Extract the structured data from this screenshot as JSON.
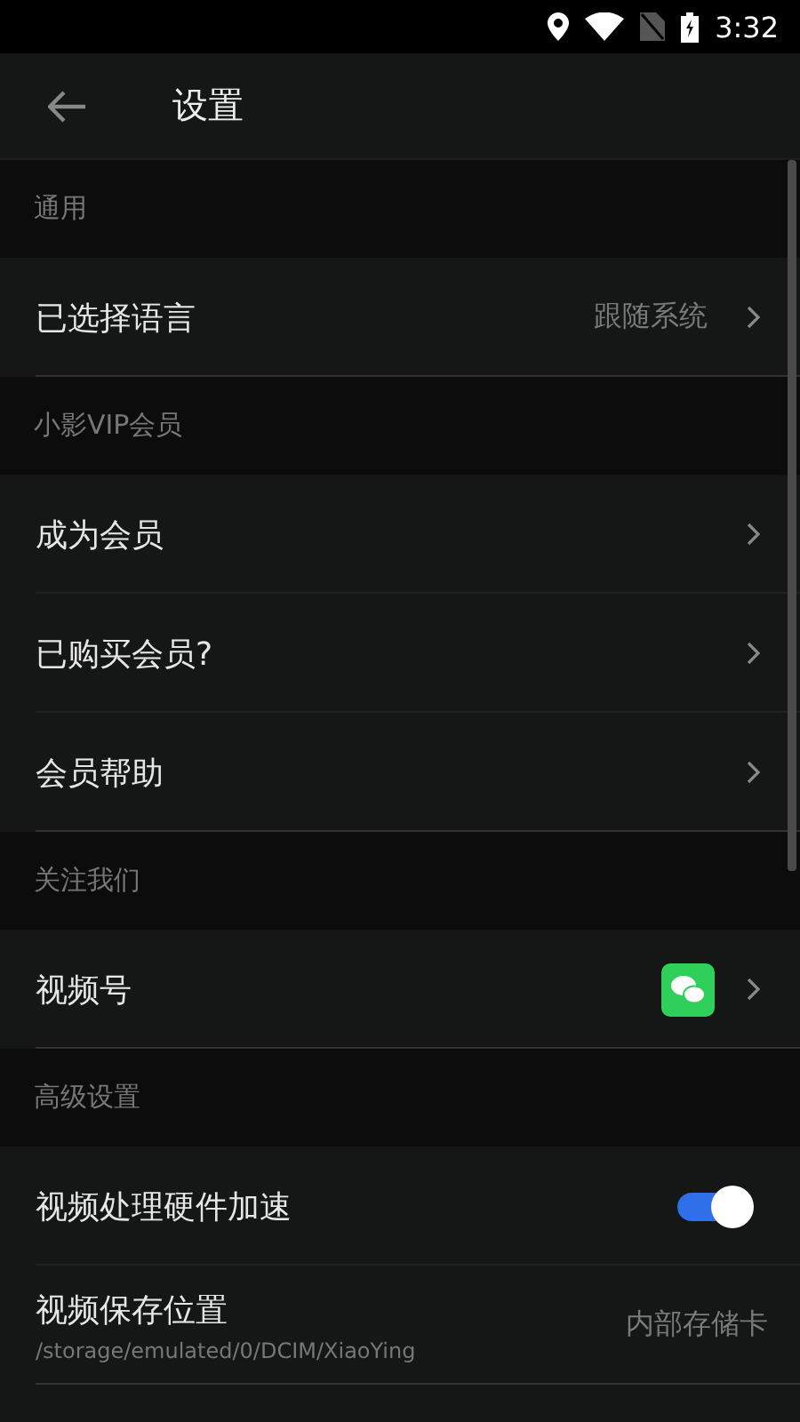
{
  "status_bar": {
    "time": "3:32"
  },
  "app_bar": {
    "title": "设置"
  },
  "sections": [
    {
      "header": "通用",
      "items": [
        {
          "kind": "link",
          "label": "已选择语言",
          "value": "跟随系统"
        }
      ]
    },
    {
      "header": "小影VIP会员",
      "items": [
        {
          "kind": "link",
          "label": "成为会员"
        },
        {
          "kind": "link",
          "label": "已购买会员?"
        },
        {
          "kind": "link",
          "label": "会员帮助"
        }
      ]
    },
    {
      "header": "关注我们",
      "items": [
        {
          "kind": "wechat",
          "label": "视频号"
        }
      ]
    },
    {
      "header": "高级设置",
      "items": [
        {
          "kind": "toggle",
          "label": "视频处理硬件加速",
          "on": true
        },
        {
          "kind": "path",
          "label": "视频保存位置",
          "subtitle": "/storage/emulated/0/DCIM/XiaoYing",
          "value": "内部存储卡"
        }
      ]
    }
  ]
}
